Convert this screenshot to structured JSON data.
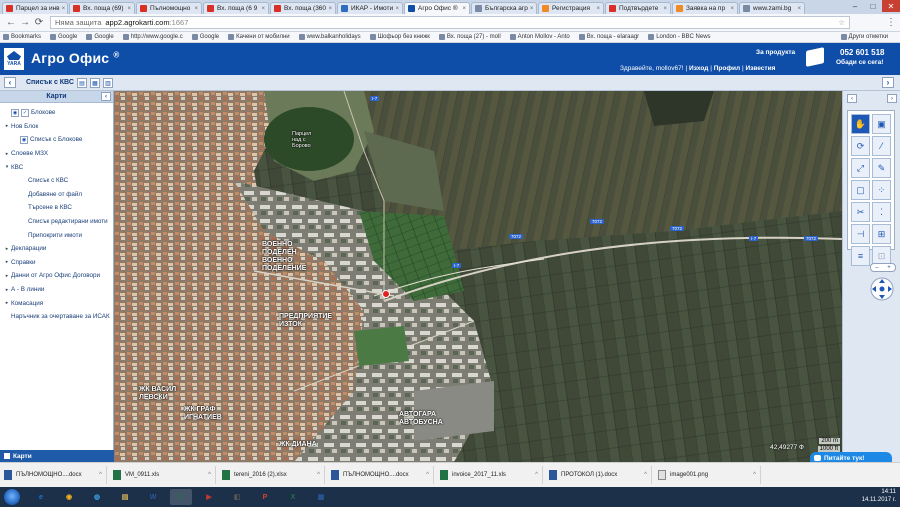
{
  "browser": {
    "tabs": [
      {
        "label": "Парцел за инв",
        "icon_color": "#d93025"
      },
      {
        "label": "Вх. поща (69)",
        "icon_color": "#d93025"
      },
      {
        "label": "Пълномощно",
        "icon_color": "#d93025"
      },
      {
        "label": "Вх. поща (6 9",
        "icon_color": "#d93025"
      },
      {
        "label": "Вх. поща (360",
        "icon_color": "#d93025"
      },
      {
        "label": "ИКАР - Имоти",
        "icon_color": "#2c6dbf"
      },
      {
        "label": "Агро Офис ®",
        "icon_color": "#0f4ea8"
      },
      {
        "label": "Българска агр",
        "icon_color": "#7a8aa5"
      },
      {
        "label": "Регистрация",
        "icon_color": "#f08a24"
      },
      {
        "label": "Подтвърдете",
        "icon_color": "#d93025"
      },
      {
        "label": "Заявка на пр",
        "icon_color": "#f08a24"
      },
      {
        "label": "www.zami.bg",
        "icon_color": "#7a8aa5"
      }
    ],
    "active_tab_index": 6,
    "security_label": "Няма защита",
    "url_host": "app2.agrokarti.com",
    "url_port": ":1667",
    "bookmarks": [
      "Bookmarks",
      "Google",
      "Google",
      "http://www.google.c",
      "Google",
      "Качени от мобилни",
      "www.balkanholidays",
      "Шофьор без книжк",
      "Вх. поща (27) - moll",
      "Anton Mollov - Anto",
      "Вх. поща - elaraagr",
      "London - BBC News"
    ],
    "other_bookmarks": "Други отметки"
  },
  "app": {
    "title": "Агро Офис",
    "title_mark": "®",
    "logo_text": "YARA",
    "about_link": "За продукта",
    "greeting": "Здравейте, mollov67!",
    "nav_links": [
      "Изход",
      "Профил",
      "Известия"
    ],
    "phone": "052 601 518",
    "call_us": "Обади се сега!"
  },
  "subbar": {
    "left_arrow": "‹",
    "title": "Списък с КВС",
    "right_arrow": "›"
  },
  "sidebar": {
    "title": "Карти",
    "items": [
      {
        "label": "Блокове",
        "level": "l1",
        "arrow": "",
        "icons": 2
      },
      {
        "label": "Нов Блок",
        "level": "l1",
        "arrow": "▸",
        "icons": 0
      },
      {
        "label": "Списък с Блокове",
        "level": "l2s",
        "arrow": "",
        "icons": 1
      },
      {
        "label": "Слоеве МЗХ",
        "level": "l1",
        "arrow": "▸",
        "icons": 0
      },
      {
        "label": "КВС",
        "level": "l1",
        "arrow": "▾",
        "icons": 0
      },
      {
        "label": "Списък с КВС",
        "level": "l2",
        "arrow": "",
        "icons": 0
      },
      {
        "label": "Добавяне от файл",
        "level": "l2",
        "arrow": "",
        "icons": 0
      },
      {
        "label": "Търсене в КВС",
        "level": "l2",
        "arrow": "",
        "icons": 0
      },
      {
        "label": "Списък редактирани имоти",
        "level": "l2",
        "arrow": "",
        "icons": 0
      },
      {
        "label": "Припокрити имоти",
        "level": "l2",
        "arrow": "",
        "icons": 0
      },
      {
        "label": "Декларации",
        "level": "l1",
        "arrow": "▸",
        "icons": 0
      },
      {
        "label": "Справки",
        "level": "l1",
        "arrow": "▸",
        "icons": 0
      },
      {
        "label": "Данни от Агро Офис Договори",
        "level": "l1",
        "arrow": "▸",
        "icons": 0
      },
      {
        "label": "А - В линии",
        "level": "l1",
        "arrow": "▸",
        "icons": 0
      },
      {
        "label": "Комасация",
        "level": "l1",
        "arrow": "▸",
        "icons": 0
      },
      {
        "label": "Наръчник за очертаване за ИСАК",
        "level": "l1",
        "arrow": "",
        "icons": 0
      }
    ],
    "footer": "Карти"
  },
  "map": {
    "labels": [
      {
        "text": "Парцел\nнад с\nБорово",
        "cls": "small"
      },
      {
        "text": "ВОЕННО\nПОДЕЛЕН\nВОЕННО\nПОДЕЛЕНИЕ"
      },
      {
        "text": "ПРЕДПРИЯТИЕ\nИЗТОК"
      },
      {
        "text": "ЖК ВАСИЛ\nЛЕВСКИ"
      },
      {
        "text": "ЖК ГРАФ\nИГНАТИЕВ"
      },
      {
        "text": "АВТОГАРА\nАВТОБУСНА"
      },
      {
        "text": "ЖК ДИАНА"
      }
    ],
    "road_labels": [
      "I-7",
      "7072",
      "7072",
      "7072",
      "I-7",
      "I-7",
      "7072"
    ],
    "coords": "42,49277 Ф",
    "scale_m": "200 m",
    "scale_ft": "1000 ft"
  },
  "tools": {
    "rows": [
      [
        "hand-icon",
        "camera-icon"
      ],
      [
        "refresh-icon",
        "ruler-icon"
      ],
      [
        "fit-icon",
        "edit-icon"
      ],
      [
        "frame-icon",
        "footprint-icon"
      ],
      [
        "scissors-icon",
        "vertex-icon"
      ],
      [
        "split-icon",
        "grid-icon"
      ],
      [
        "layers-icon",
        "lock-icon"
      ]
    ],
    "glyphs": {
      "hand-icon": "✋",
      "camera-icon": "▣",
      "refresh-icon": "⟳",
      "ruler-icon": "⁄",
      "fit-icon": "⤢",
      "edit-icon": "✎",
      "frame-icon": "▢",
      "footprint-icon": "⁘",
      "scissors-icon": "✂",
      "vertex-icon": "⁚",
      "split-icon": "⊣",
      "grid-icon": "⊞",
      "layers-icon": "≡",
      "lock-icon": "⊡"
    },
    "active": "hand-icon",
    "disabled": [
      "lock-icon"
    ]
  },
  "chat_button": "Питайте тук!",
  "downloads": [
    {
      "name": "ПЪЛНОМОЩНО....docx",
      "type": "w"
    },
    {
      "name": "VM_0911.xls",
      "type": "x"
    },
    {
      "name": "tereni_2016 (2).xlsx",
      "type": "x"
    },
    {
      "name": "ПЪЛНОМОЩНО....docx",
      "type": "w"
    },
    {
      "name": "invoice_2017_11.xls",
      "type": "x"
    },
    {
      "name": "ПРОТОКОЛ (1).docx",
      "type": "w"
    },
    {
      "name": "image001.png",
      "type": "p"
    }
  ],
  "taskbar": {
    "apps": [
      "e",
      "◉",
      "◍",
      "▤",
      "W",
      "X",
      "▶",
      "◧",
      "P",
      "X",
      "▦"
    ],
    "active_index": 5,
    "time": "14:11",
    "date": "14.11.2017 г."
  }
}
